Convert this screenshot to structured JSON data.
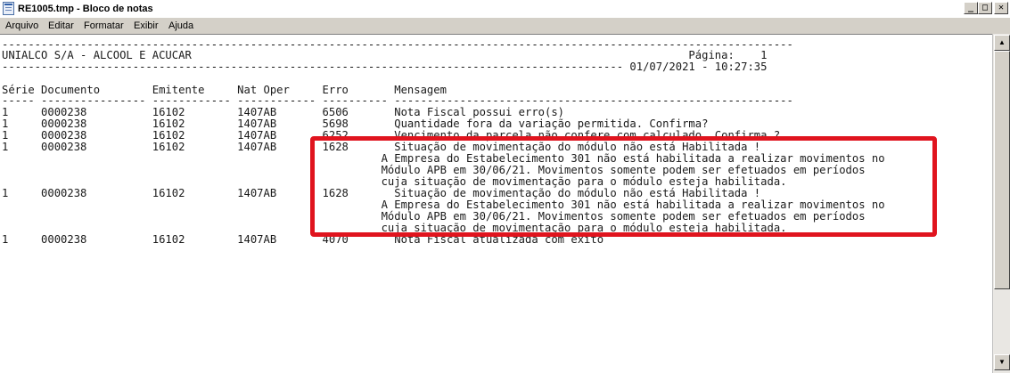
{
  "window": {
    "title": "RE1005.tmp - Bloco de notas",
    "icon": "notepad-icon"
  },
  "controls": {
    "minimize": "_",
    "maximize": "□",
    "close": "✕"
  },
  "menu": [
    "Arquivo",
    "Editar",
    "Formatar",
    "Exibir",
    "Ajuda"
  ],
  "document": {
    "lines": [
      "-------------------------------------------------------------------------------------------------------------------------",
      "UNIALCO S/A - ALCOOL E ACUCAR                                                                            Página:    1",
      "----------------------------------------------------------------------------------------------- 01/07/2021 - 10:27:35",
      "",
      "Série Documento        Emitente     Nat Oper     Erro       Mensagem",
      "----- ---------------- ------------ ------------ ---------- -------------------------------------------------------------",
      "1     0000238          16102        1407AB       6506       Nota Fiscal possui erro(s)",
      "1     0000238          16102        1407AB       5698       Quantidade fora da variação permitida. Confirma?",
      "1     0000238          16102        1407AB       6252       Vencimento da parcela não confere com calculado. Confirma ?",
      "1     0000238          16102        1407AB       1628       Situação de movimentação do módulo não está Habilitada !",
      "                                                          A Empresa do Estabelecimento 301 não está habilitada a realizar movimentos no",
      "                                                          Módulo APB em 30/06/21. Movimentos somente podem ser efetuados em períodos",
      "                                                          cuja situação de movimentação para o módulo esteja habilitada.",
      "",
      "1     0000238          16102        1407AB       1628       Situação de movimentação do módulo não está Habilitada !",
      "                                                          A Empresa do Estabelecimento 301 não está habilitada a realizar movimentos no",
      "                                                          Módulo APB em 30/06/21. Movimentos somente podem ser efetuados em períodos",
      "                                                          cuja situação de movimentação para o módulo esteja habilitada.",
      "",
      "1     0000238          16102        1407AB       4070       Nota Fiscal atualizada com êxito"
    ]
  },
  "scrollbar": {
    "up": "▲",
    "down": "▼"
  },
  "colors": {
    "highlight": "#e0141e"
  }
}
